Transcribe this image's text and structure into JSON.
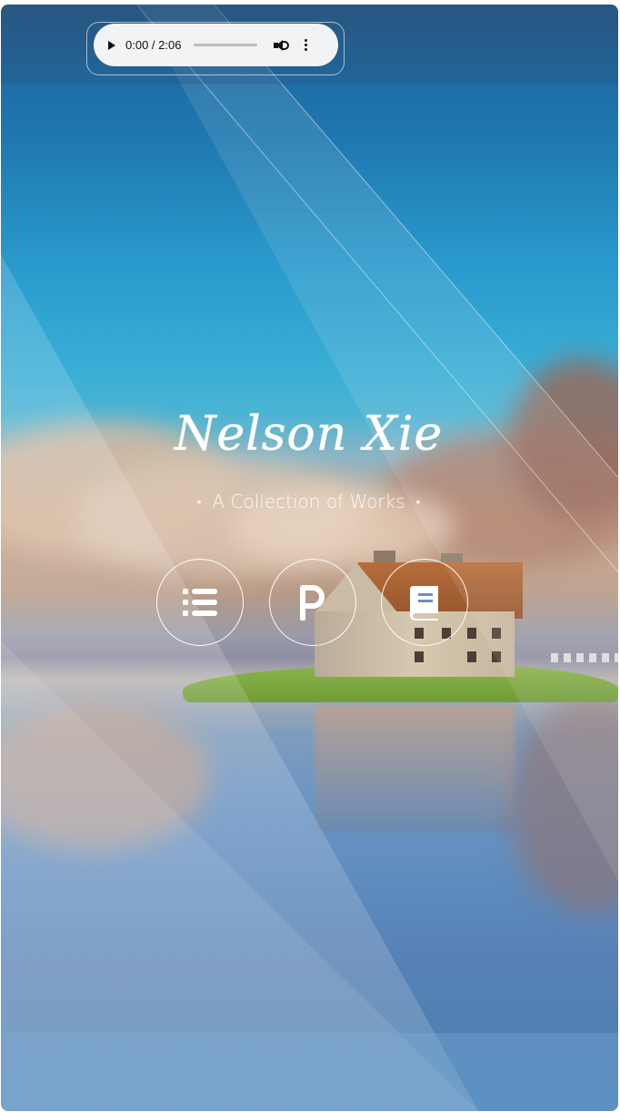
{
  "audio_player": {
    "time": "0:00 / 2:06",
    "progress": 0
  },
  "hero": {
    "title": "Nelson Xie",
    "subtitle": "A Collection of Works",
    "separator": "•"
  },
  "nav": [
    {
      "icon": "list-icon"
    },
    {
      "icon": "p-letter-icon"
    },
    {
      "icon": "book-icon"
    }
  ],
  "colors": {
    "sky": "#2a9bcd",
    "player_bg": "#f1f3f4",
    "roof": "#b86d3a"
  }
}
